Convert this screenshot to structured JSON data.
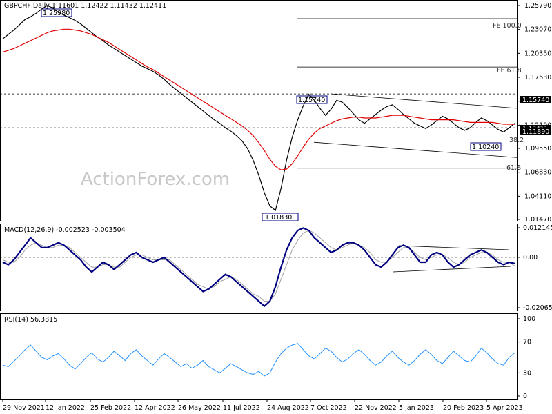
{
  "chart_data": {
    "type": "line",
    "symbol_header": "GBPCHF,Daily  1.11601 1.12422 1.11432 1.12411",
    "watermark": "ActionForex.com",
    "x_ticks": [
      "29 Nov 2021",
      "12 Jan 2022",
      "25 Feb 2022",
      "12 Apr 2022",
      "26 May 2022",
      "11 Jul 2022",
      "24 Aug 2022",
      "7 Oct 2022",
      "22 Nov 2022",
      "5 Jan 2023",
      "20 Feb 2023",
      "5 Apr 2023"
    ],
    "price_panel": {
      "y_ticks": [
        "1.25790",
        "1.23070",
        "1.20350",
        "1.17630",
        "1.14910",
        "1.12190",
        "1.09550",
        "1.06830",
        "1.04110",
        "1.01470"
      ],
      "ylim": [
        1.0147,
        1.2579
      ],
      "current_price": "1.12411",
      "level_labels": [
        "1.15740",
        "1.11890"
      ],
      "close": [
        1.22,
        1.225,
        1.23,
        1.236,
        1.242,
        1.245,
        1.249,
        1.254,
        1.258,
        1.255,
        1.25,
        1.247,
        1.244,
        1.241,
        1.237,
        1.232,
        1.227,
        1.222,
        1.218,
        1.213,
        1.209,
        1.205,
        1.201,
        1.197,
        1.193,
        1.189,
        1.186,
        1.183,
        1.179,
        1.174,
        1.168,
        1.163,
        1.158,
        1.153,
        1.148,
        1.143,
        1.138,
        1.133,
        1.128,
        1.124,
        1.119,
        1.115,
        1.11,
        1.104,
        1.095,
        1.082,
        1.065,
        1.045,
        1.03,
        1.025,
        1.05,
        1.082,
        1.108,
        1.128,
        1.144,
        1.157,
        1.15,
        1.141,
        1.133,
        1.14,
        1.15,
        1.148,
        1.142,
        1.135,
        1.128,
        1.124,
        1.129,
        1.134,
        1.139,
        1.143,
        1.145,
        1.14,
        1.134,
        1.129,
        1.124,
        1.121,
        1.118,
        1.122,
        1.127,
        1.132,
        1.129,
        1.124,
        1.119,
        1.116,
        1.119,
        1.125,
        1.13,
        1.127,
        1.122,
        1.117,
        1.114,
        1.119,
        1.124
      ],
      "ma": [
        1.205,
        1.207,
        1.209,
        1.212,
        1.215,
        1.218,
        1.221,
        1.224,
        1.227,
        1.229,
        1.23,
        1.231,
        1.231,
        1.23,
        1.229,
        1.227,
        1.225,
        1.222,
        1.219,
        1.216,
        1.212,
        1.208,
        1.204,
        1.2,
        1.196,
        1.192,
        1.188,
        1.185,
        1.181,
        1.177,
        1.173,
        1.169,
        1.165,
        1.161,
        1.157,
        1.153,
        1.149,
        1.145,
        1.141,
        1.137,
        1.133,
        1.129,
        1.125,
        1.121,
        1.116,
        1.11,
        1.102,
        1.093,
        1.083,
        1.075,
        1.071,
        1.072,
        1.078,
        1.087,
        1.097,
        1.106,
        1.113,
        1.118,
        1.121,
        1.124,
        1.127,
        1.129,
        1.13,
        1.131,
        1.131,
        1.13,
        1.13,
        1.13,
        1.131,
        1.132,
        1.133,
        1.133,
        1.133,
        1.132,
        1.131,
        1.13,
        1.129,
        1.128,
        1.128,
        1.128,
        1.128,
        1.128,
        1.127,
        1.126,
        1.125,
        1.125,
        1.125,
        1.125,
        1.125,
        1.124,
        1.123,
        1.123,
        1.123
      ],
      "annotations": [
        {
          "text": "1.25980",
          "price": 1.2598
        },
        {
          "text": "1.15740",
          "price": 1.1574
        },
        {
          "text": "1.10240",
          "price": 1.1024
        },
        {
          "text": "1.01830",
          "price": 1.0183
        },
        {
          "text": "FE 100.0",
          "price": 1.243
        },
        {
          "text": "FE 61.8",
          "price": 1.188
        },
        {
          "text": "61.8",
          "price": 1.073
        },
        {
          "text": "38.2",
          "price": 1.106
        }
      ]
    },
    "macd_panel": {
      "title": "MACD(12,26,9) -0.002523 -0.003504",
      "y_ticks": [
        "0.012145",
        "0.00",
        "-0.020656"
      ],
      "ylim": [
        -0.020656,
        0.012145
      ],
      "macd": [
        -0.002,
        -0.003,
        -0.001,
        0.002,
        0.005,
        0.008,
        0.006,
        0.004,
        0.004,
        0.005,
        0.006,
        0.005,
        0.003,
        0.001,
        -0.001,
        -0.004,
        -0.006,
        -0.004,
        -0.002,
        -0.003,
        -0.005,
        -0.003,
        -0.001,
        0.001,
        0.002,
        0.0,
        -0.001,
        -0.002,
        -0.001,
        0.0,
        -0.002,
        -0.004,
        -0.006,
        -0.008,
        -0.01,
        -0.012,
        -0.014,
        -0.013,
        -0.011,
        -0.009,
        -0.007,
        -0.008,
        -0.01,
        -0.012,
        -0.014,
        -0.016,
        -0.018,
        -0.02,
        -0.018,
        -0.012,
        -0.004,
        0.003,
        0.008,
        0.011,
        0.012,
        0.011,
        0.008,
        0.006,
        0.004,
        0.002,
        0.003,
        0.005,
        0.006,
        0.006,
        0.005,
        0.003,
        0.0,
        -0.003,
        -0.004,
        -0.002,
        0.001,
        0.004,
        0.005,
        0.004,
        0.001,
        -0.002,
        -0.002,
        0.001,
        0.002,
        0.001,
        -0.002,
        -0.004,
        -0.003,
        -0.001,
        0.001,
        0.002,
        0.003,
        0.002,
        0.0,
        -0.002,
        -0.003,
        -0.002,
        -0.0025
      ],
      "signal": [
        -0.001,
        -0.002,
        -0.002,
        0.0,
        0.003,
        0.005,
        0.006,
        0.005,
        0.004,
        0.004,
        0.005,
        0.005,
        0.004,
        0.002,
        0.0,
        -0.002,
        -0.004,
        -0.004,
        -0.003,
        -0.003,
        -0.004,
        -0.004,
        -0.002,
        0.0,
        0.001,
        0.001,
        0.0,
        -0.001,
        -0.001,
        -0.001,
        -0.001,
        -0.003,
        -0.005,
        -0.007,
        -0.009,
        -0.011,
        -0.012,
        -0.013,
        -0.012,
        -0.01,
        -0.009,
        -0.008,
        -0.009,
        -0.011,
        -0.013,
        -0.015,
        -0.016,
        -0.018,
        -0.018,
        -0.015,
        -0.009,
        -0.003,
        0.003,
        0.007,
        0.01,
        0.011,
        0.01,
        0.008,
        0.006,
        0.004,
        0.003,
        0.004,
        0.005,
        0.006,
        0.005,
        0.004,
        0.002,
        -0.001,
        -0.002,
        -0.002,
        0.0,
        0.002,
        0.004,
        0.004,
        0.002,
        0.0,
        -0.001,
        0.0,
        0.001,
        0.001,
        0.0,
        -0.002,
        -0.003,
        -0.002,
        0.0,
        0.001,
        0.002,
        0.002,
        0.001,
        -0.001,
        -0.002,
        -0.002,
        -0.0035
      ]
    },
    "rsi_panel": {
      "title": "RSI(14) 56.3815",
      "y_ticks": [
        "100",
        "70",
        "30",
        "0"
      ],
      "ylim": [
        0,
        100
      ],
      "rsi": [
        40,
        38,
        45,
        52,
        60,
        66,
        58,
        50,
        47,
        52,
        55,
        48,
        40,
        35,
        42,
        50,
        56,
        48,
        44,
        50,
        58,
        52,
        46,
        55,
        60,
        52,
        46,
        40,
        48,
        55,
        50,
        44,
        38,
        42,
        36,
        40,
        46,
        38,
        34,
        30,
        36,
        42,
        38,
        34,
        30,
        28,
        32,
        26,
        30,
        44,
        55,
        62,
        66,
        68,
        60,
        52,
        48,
        55,
        62,
        58,
        50,
        44,
        48,
        55,
        60,
        54,
        46,
        40,
        44,
        52,
        58,
        50,
        44,
        40,
        46,
        54,
        60,
        54,
        46,
        42,
        50,
        58,
        52,
        46,
        44,
        52,
        62,
        56,
        48,
        42,
        40,
        50,
        56
      ]
    },
    "colors": {
      "price": "#000000",
      "ma": "#e00000",
      "macd": "#000080",
      "signal": "#a0a0a0",
      "rsi": "#1e90ff",
      "watermark": "#c8c8c8"
    }
  }
}
